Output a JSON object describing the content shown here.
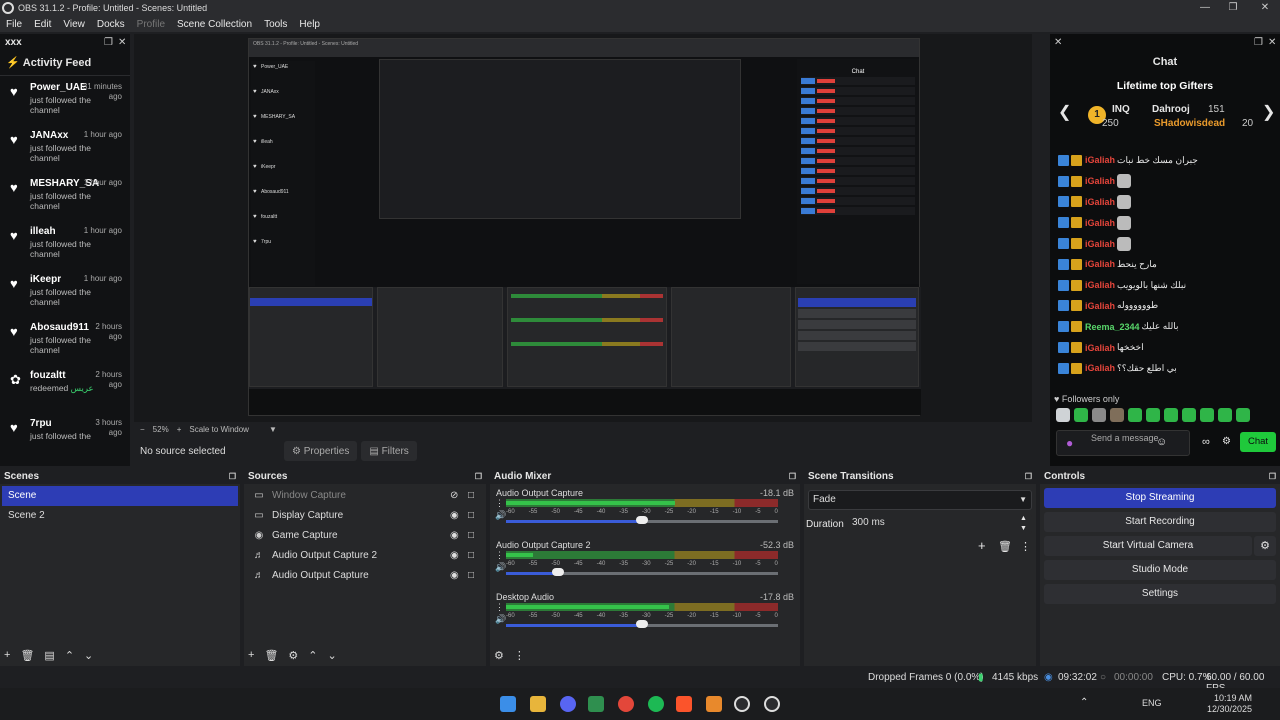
{
  "window": {
    "title": "OBS 31.1.2 - Profile: Untitled - Scenes: Untitled"
  },
  "menu": [
    "File",
    "Edit",
    "View",
    "Docks",
    "Profile",
    "Scene Collection",
    "Tools",
    "Help"
  ],
  "activity": {
    "dock_title": "xxx",
    "feed_title": "Activity Feed",
    "items": [
      {
        "name": "Power_UAE",
        "time": "31 minutes ago",
        "desc": "just followed the channel"
      },
      {
        "name": "JANAxx",
        "time": "1 hour ago",
        "desc": "just followed the channel"
      },
      {
        "name": "MESHARY_SA",
        "time": "1 hour ago",
        "desc": "just followed the channel"
      },
      {
        "name": "illeah",
        "time": "1 hour ago",
        "desc": "just followed the channel"
      },
      {
        "name": "iKeepr",
        "time": "1 hour ago",
        "desc": "just followed the channel"
      },
      {
        "name": "Abosaud911",
        "time": "2 hours ago",
        "desc": "just followed the channel"
      },
      {
        "name": "fouzaltt",
        "time": "2 hours ago",
        "desc": "redeemed",
        "gift": "عريس"
      },
      {
        "name": "7rpu",
        "time": "3 hours ago",
        "desc": "just followed the"
      }
    ]
  },
  "preview": {
    "zoom": "52%",
    "scale_mode": "Scale to Window",
    "no_source": "No source selected",
    "properties": "Properties",
    "filters": "Filters"
  },
  "chat": {
    "title": "Chat",
    "gifters_title": "Lifetime top Gifters",
    "gifters": [
      {
        "rank": "1",
        "name": "INQ",
        "count": "250"
      },
      {
        "name": "Dahrooj",
        "count": "151"
      },
      {
        "name": "SHadowisdead",
        "count": "20"
      }
    ],
    "messages": [
      {
        "user": "iGaliah",
        "text": "جبران مسك خط نبات"
      },
      {
        "user": "iGaliah",
        "text": ""
      },
      {
        "user": "iGaliah",
        "text": ""
      },
      {
        "user": "iGaliah",
        "text": ""
      },
      {
        "user": "iGaliah",
        "text": ""
      },
      {
        "user": "iGaliah",
        "text": "مارح ينحط"
      },
      {
        "user": "iGaliah",
        "text": "نبلك شنها بالويويب"
      },
      {
        "user": "iGaliah",
        "text": "طووووووله"
      },
      {
        "user": "Reema_2344",
        "text": "بالله عليك"
      },
      {
        "user": "iGaliah",
        "text": "اخخخها"
      },
      {
        "user": "iGaliah",
        "text": "بي اطلع حقك؟؟"
      }
    ],
    "followers_only": "Followers only",
    "send_placeholder": "Send a message",
    "chat_button": "Chat"
  },
  "scenes": {
    "title": "Scenes",
    "items": [
      "Scene",
      "Scene 2"
    ]
  },
  "sources": {
    "title": "Sources",
    "items": [
      "Window Capture",
      "Display Capture",
      "Game Capture",
      "Audio Output Capture 2",
      "Audio Output Capture"
    ]
  },
  "mixer": {
    "title": "Audio Mixer",
    "scale": [
      "-60",
      "-55",
      "-50",
      "-45",
      "-40",
      "-35",
      "-30",
      "-25",
      "-20",
      "-15",
      "-10",
      "-5",
      "0"
    ],
    "channels": [
      {
        "name": "Audio Output Capture",
        "db": "-18.1 dB",
        "level": 0.62,
        "volume": 0.5
      },
      {
        "name": "Audio Output Capture 2",
        "db": "-52.3 dB",
        "level": 0.1,
        "volume": 0.19
      },
      {
        "name": "Desktop Audio",
        "db": "-17.8 dB",
        "level": 0.6,
        "volume": 0.5
      }
    ]
  },
  "transitions": {
    "title": "Scene Transitions",
    "selected": "Fade",
    "duration_label": "Duration",
    "duration_value": "300 ms"
  },
  "controls": {
    "title": "Controls",
    "buttons": [
      "Stop Streaming",
      "Start Recording",
      "Start Virtual Camera",
      "Studio Mode",
      "Settings"
    ]
  },
  "status": {
    "dropped": "Dropped Frames 0 (0.0%)",
    "bitrate": "4145 kbps",
    "stream_time": "09:32:02",
    "rec_time": "00:00:00",
    "cpu": "CPU: 0.7%",
    "fps": "60.00 / 60.00 FPS"
  },
  "taskbar": {
    "lang": "ENG",
    "time": "10:19 AM",
    "date": "12/30/2025"
  },
  "colors": {
    "accent": "#2d3db5",
    "chat_green": "#1fc93b",
    "username_red": "#e5453b"
  }
}
